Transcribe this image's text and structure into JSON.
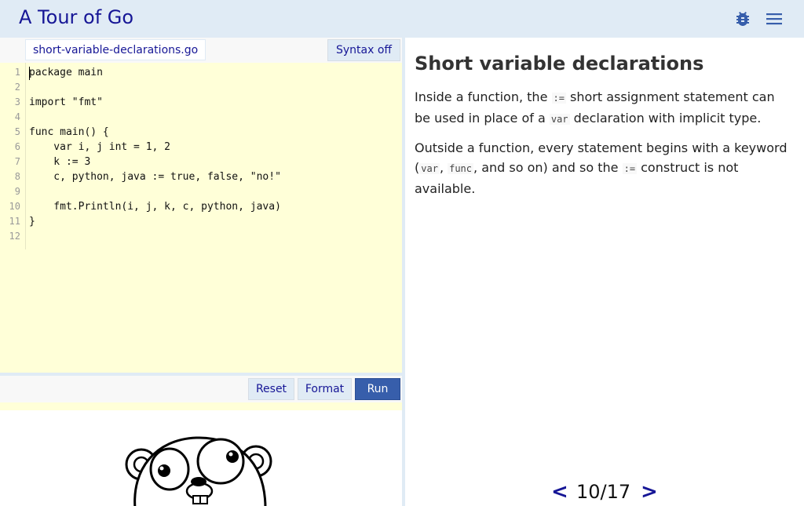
{
  "app": {
    "title": "A Tour of Go"
  },
  "toolbar": {
    "bug_icon": "bug-icon",
    "menu_icon": "hamburger-menu-icon"
  },
  "editor": {
    "file_tab": "short-variable-declarations.go",
    "syntax_toggle": "Syntax off",
    "line_numbers": [
      "1",
      "2",
      "3",
      "4",
      "5",
      "6",
      "7",
      "8",
      "9",
      "10",
      "11",
      "12"
    ],
    "code_lines": [
      "package main",
      "",
      "import \"fmt\"",
      "",
      "func main() {",
      "    var i, j int = 1, 2",
      "    k := 3",
      "    c, python, java := true, false, \"no!\"",
      "",
      "    fmt.Println(i, j, k, c, python, java)",
      "}",
      ""
    ]
  },
  "output_bar": {
    "reset_label": "Reset",
    "format_label": "Format",
    "run_label": "Run"
  },
  "lesson": {
    "title": "Short variable declarations",
    "para1": {
      "t1": "Inside a function, the ",
      "c1": ":=",
      "t2": " short assignment statement can be used in place of a ",
      "c2": "var",
      "t3": " declaration with implicit type."
    },
    "para2": {
      "t1": "Outside a function, every statement begins with a keyword (",
      "c1": "var",
      "t2": ", ",
      "c2": "func",
      "t3": ", and so on) and so the ",
      "c3": ":=",
      "t4": " construct is not available."
    }
  },
  "pager": {
    "prev": "<",
    "position": "10/17",
    "next": ">"
  },
  "colors": {
    "brand": "#161696",
    "topbar_bg": "#e0ebf5",
    "editor_bg": "#ffffd8",
    "run_button": "#375eab"
  }
}
